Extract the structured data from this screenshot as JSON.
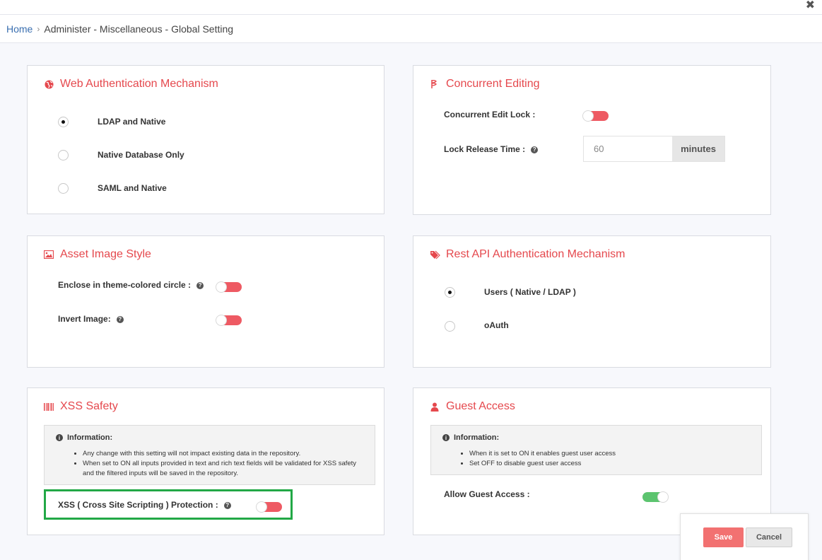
{
  "window": {
    "close_symbol": "✖"
  },
  "breadcrumb": {
    "home": "Home",
    "separator": "›",
    "current": "Administer - Miscellaneous - Global Setting"
  },
  "web_auth": {
    "title": "Web Authentication Mechanism",
    "icon": "globe-icon",
    "options": [
      {
        "label": "LDAP and Native",
        "checked": true
      },
      {
        "label": "Native Database Only",
        "checked": false
      },
      {
        "label": "SAML and Native",
        "checked": false
      }
    ]
  },
  "concurrent": {
    "title": "Concurrent Editing",
    "icon": "flag-icon",
    "lock_label": "Concurrent Edit Lock :",
    "lock_on": false,
    "release_label": "Lock Release Time :",
    "release_value": "60",
    "release_unit": "minutes"
  },
  "asset_image": {
    "title": "Asset Image Style",
    "icon": "image-icon",
    "enclose_label": "Enclose in theme-colored circle :",
    "enclose_on": false,
    "invert_label": "Invert Image:",
    "invert_on": false
  },
  "rest_api": {
    "title": "Rest API Authentication Mechanism",
    "icon": "tags-icon",
    "options": [
      {
        "label": "Users ( Native / LDAP )",
        "checked": true
      },
      {
        "label": "oAuth",
        "checked": false
      }
    ]
  },
  "xss": {
    "title": "XSS Safety",
    "icon": "barcode-icon",
    "info_title": "Information:",
    "info_items": [
      "Any change with this setting will not impact existing data in the repository.",
      "When set to ON all inputs provided in text and rich text fields will be validated for XSS safety",
      "and the filtered inputs will be saved in the repository."
    ],
    "protection_label": "XSS ( Cross Site Scripting ) Protection :",
    "protection_on": false
  },
  "guest": {
    "title": "Guest Access",
    "icon": "user-icon",
    "info_title": "Information:",
    "info_items": [
      "When it is set to ON it enables guest user access",
      "Set OFF to disable guest user access"
    ],
    "allow_label": "Allow Guest Access :",
    "allow_on": true
  },
  "actions": {
    "save": "Save",
    "cancel": "Cancel"
  },
  "colors": {
    "accent": "#e5484d",
    "toggle_off": "#ee5a63",
    "toggle_on": "#5cc46f",
    "highlight": "#22a846"
  }
}
